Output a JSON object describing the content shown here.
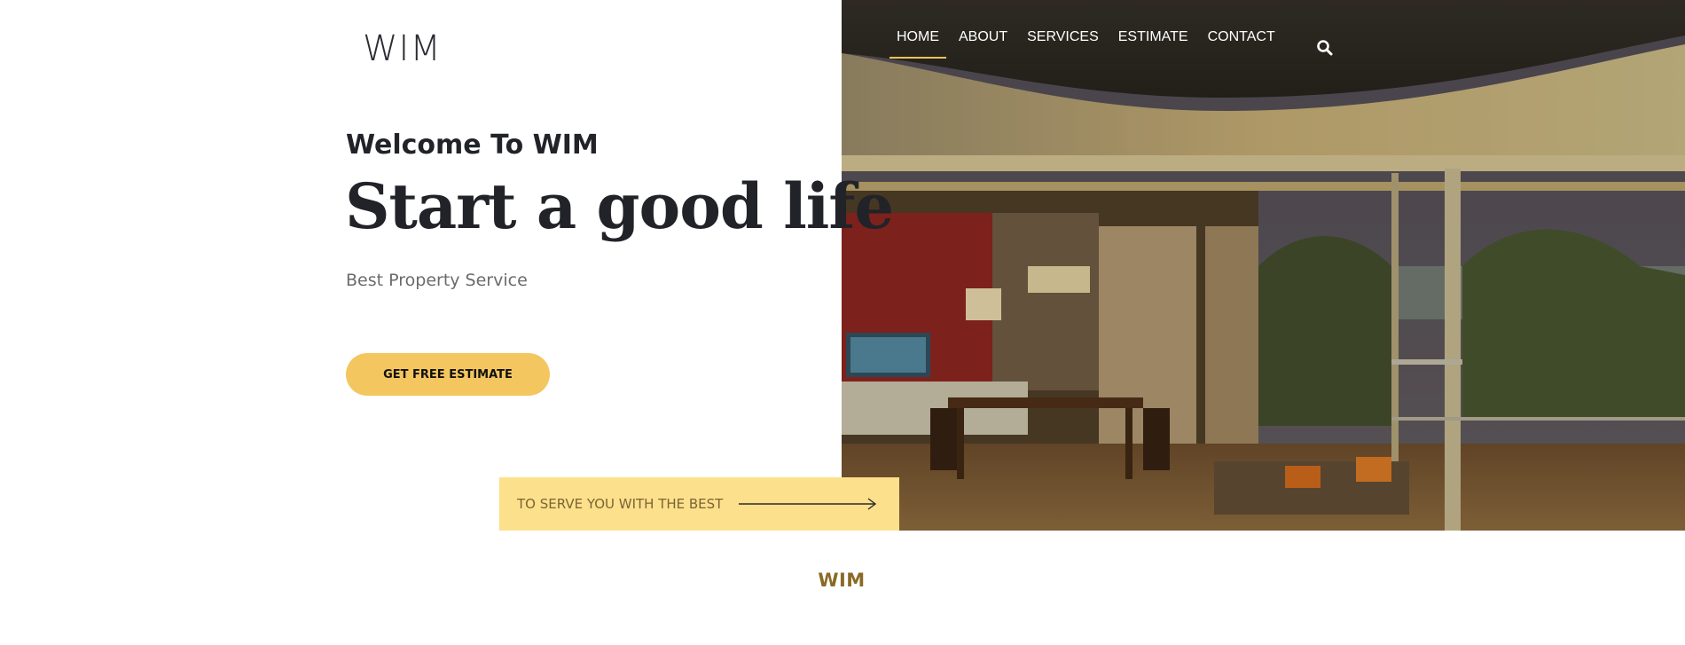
{
  "header": {
    "logo": "WIM",
    "nav": [
      "HOME",
      "ABOUT",
      "SERVICES",
      "ESTIMATE",
      "CONTACT"
    ],
    "active_nav": "HOME",
    "search_icon": "search-icon"
  },
  "hero": {
    "welcome": "Welcome To WIM",
    "headline": "Start a good life",
    "subtitle": "Best Property Service",
    "cta_label": "GET FREE ESTIMATE",
    "banner_text": "TO SERVE YOU WITH THE BEST",
    "banner_icon": "arrow-right-icon"
  },
  "section": {
    "label": "WIM"
  },
  "colors": {
    "accent": "#f4c65f",
    "banner_bg": "#fde08b",
    "text_dark": "#212329",
    "section_label": "#8a6a25"
  }
}
